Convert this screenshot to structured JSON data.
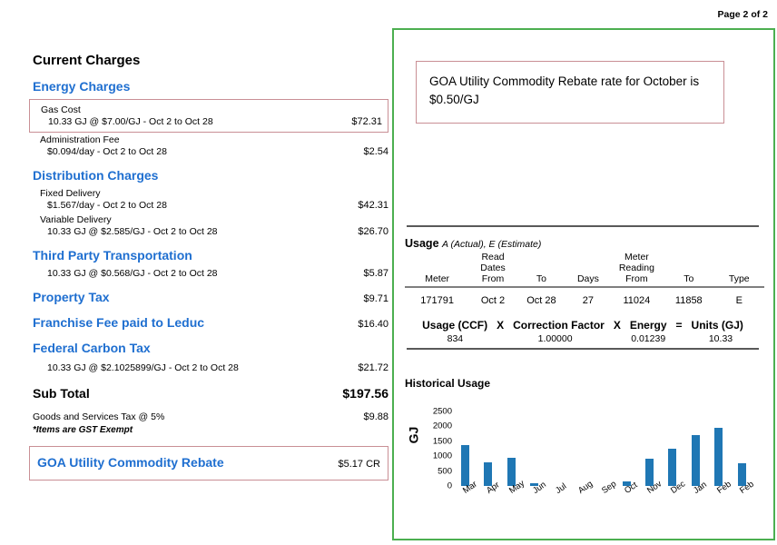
{
  "page_indicator": "Page 2 of 2",
  "left": {
    "title": "Current Charges",
    "energy_charges": {
      "heading": "Energy Charges",
      "gas_cost": {
        "label": "Gas Cost",
        "detail": "10.33 GJ @ $7.00/GJ - Oct 2 to Oct 28",
        "amount": "$72.31"
      },
      "administration_fee": {
        "label": "Administration Fee",
        "detail": "$0.094/day - Oct 2 to Oct 28",
        "amount": "$2.54"
      }
    },
    "distribution_charges": {
      "heading": "Distribution Charges",
      "fixed_delivery": {
        "label": "Fixed Delivery",
        "detail": "$1.567/day - Oct 2 to Oct 28",
        "amount": "$42.31"
      },
      "variable_delivery": {
        "label": "Variable Delivery",
        "detail": "10.33 GJ @ $2.585/GJ - Oct 2 to Oct 28",
        "amount": "$26.70"
      }
    },
    "third_party": {
      "heading": "Third Party Transportation",
      "detail": "10.33 GJ @ $0.568/GJ - Oct 2 to  Oct 28",
      "amount": "$5.87"
    },
    "property_tax": {
      "heading": "Property Tax",
      "amount": "$9.71"
    },
    "franchise_fee": {
      "heading": "Franchise Fee paid to Leduc",
      "amount": "$16.40"
    },
    "federal_carbon_tax": {
      "heading": "Federal Carbon Tax",
      "detail": "10.33 GJ @ $2.1025899/GJ - Oct 2 to Oct 28",
      "amount": "$21.72"
    },
    "sub_total": {
      "label": "Sub Total",
      "amount": "$197.56"
    },
    "gst": {
      "label": "Goods and Services Tax @ 5%",
      "amount": "$9.88"
    },
    "exempt_note": "*Items are GST Exempt",
    "rebate": {
      "label": "GOA Utility Commodity Rebate",
      "amount": "$5.17 CR"
    }
  },
  "right": {
    "notice": "GOA Utility Commodity Rebate rate for October is $0.50/GJ",
    "usage": {
      "title": "Usage",
      "title_sub": "A (Actual), E (Estimate)",
      "headers": {
        "meter": "Meter",
        "read_dates": "Read Dates",
        "read_from": "From",
        "read_to": "To",
        "days": "Days",
        "meter_reading": "Meter Reading",
        "reading_from": "From",
        "reading_to": "To",
        "type": "Type"
      },
      "row": {
        "meter": "171791",
        "read_from": "Oct 2",
        "read_to": "Oct 28",
        "days": "27",
        "reading_from": "11024",
        "reading_to": "11858",
        "type": "E"
      }
    },
    "conversion": {
      "h_usage": "Usage (CCF)",
      "op1": "X",
      "h_correction": "Correction Factor",
      "op2": "X",
      "h_energy": "Energy",
      "op3": "=",
      "h_units": "Units (GJ)",
      "v_usage": "834",
      "v_correction": "1.00000",
      "v_energy": "0.01239",
      "v_units": "10.33"
    }
  },
  "chart_data": {
    "type": "bar",
    "title": "Historical Usage",
    "xlabel": "",
    "ylabel": "GJ",
    "ylim": [
      0,
      2500
    ],
    "yticks": [
      2500,
      2000,
      1500,
      1000,
      500,
      0
    ],
    "grid": false,
    "legend": "none",
    "bar_color": "#1f77b4",
    "categories": [
      "Mar",
      "Apr",
      "May",
      "Jun",
      "Jul",
      "Aug",
      "Sep",
      "Oct",
      "Nov",
      "Dec",
      "Jan",
      "Feb",
      "Feb"
    ],
    "values": [
      1380,
      790,
      940,
      80,
      0,
      0,
      0,
      150,
      900,
      1250,
      1700,
      1950,
      760
    ]
  }
}
